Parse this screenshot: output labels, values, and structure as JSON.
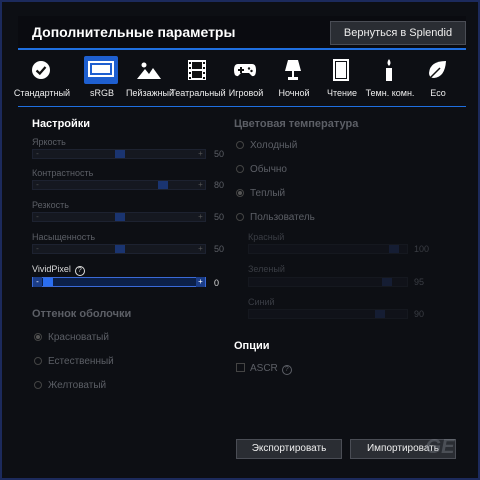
{
  "window": {
    "title": "Дополнительные параметры",
    "back_label": "Вернуться в Splendid"
  },
  "modes": [
    {
      "label": "Стандартный",
      "icon": "check-circle-icon",
      "active": false
    },
    {
      "label": "sRGB",
      "icon": "monitor-icon",
      "active": true
    },
    {
      "label": "Пейзажный",
      "icon": "mountain-icon",
      "active": false
    },
    {
      "label": "Театральный",
      "icon": "film-icon",
      "active": false
    },
    {
      "label": "Игровой",
      "icon": "gamepad-icon",
      "active": false
    },
    {
      "label": "Ночной",
      "icon": "lamp-icon",
      "active": false
    },
    {
      "label": "Чтение",
      "icon": "book-icon",
      "active": false
    },
    {
      "label": "Темн. комн.",
      "icon": "candle-icon",
      "active": false
    },
    {
      "label": "Eco",
      "icon": "leaf-icon",
      "active": false
    }
  ],
  "settings": {
    "title": "Настройки",
    "sliders": [
      {
        "label": "Яркость",
        "value": 50,
        "enabled": false
      },
      {
        "label": "Контрастность",
        "value": 80,
        "enabled": false
      },
      {
        "label": "Резкость",
        "value": 50,
        "enabled": false
      },
      {
        "label": "Насыщенность",
        "value": 50,
        "enabled": false
      },
      {
        "label": "VividPixel",
        "value": 0,
        "enabled": true
      }
    ],
    "minus": "-",
    "plus": "+",
    "help": "?"
  },
  "skin": {
    "title": "Оттенок оболочки",
    "options": [
      "Красноватый",
      "Естественный",
      "Желтоватый"
    ],
    "selected": 0
  },
  "color_temp": {
    "title": "Цветовая температура",
    "options": [
      "Холодный",
      "Обычно",
      "Теплый",
      "Пользователь"
    ],
    "selected": 2,
    "sliders": [
      {
        "label": "Красный",
        "value": 100
      },
      {
        "label": "Зеленый",
        "value": 95
      },
      {
        "label": "Синий",
        "value": 90
      }
    ]
  },
  "options": {
    "title": "Опции",
    "asrc_label": "ASCR",
    "help": "?"
  },
  "buttons": {
    "export": "Экспортировать",
    "import": "Импортировать"
  },
  "watermark": "GE",
  "colors": {
    "accent": "#1f6fe0",
    "active_mode": "#1e5fd0",
    "background": "#0d0f14"
  }
}
